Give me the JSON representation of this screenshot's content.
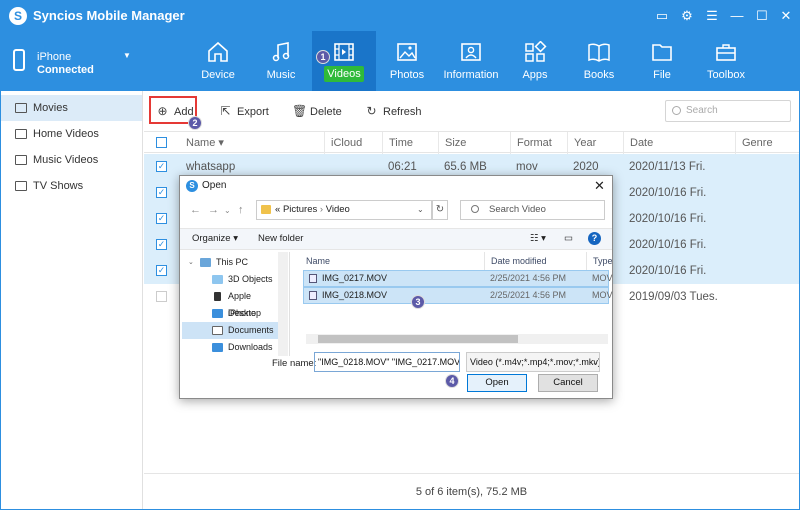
{
  "app": {
    "title": "Syncios Mobile Manager",
    "accent": "#2d8fe0"
  },
  "device": {
    "name": "iPhone",
    "status": "Connected"
  },
  "nav": [
    {
      "label": "Device",
      "icon": "home-icon"
    },
    {
      "label": "Music",
      "icon": "music-note-icon"
    },
    {
      "label": "Videos",
      "icon": "film-icon"
    },
    {
      "label": "Photos",
      "icon": "image-icon"
    },
    {
      "label": "Information",
      "icon": "contact-card-icon"
    },
    {
      "label": "Apps",
      "icon": "apps-grid-icon"
    },
    {
      "label": "Books",
      "icon": "book-icon"
    },
    {
      "label": "File",
      "icon": "file-icon"
    },
    {
      "label": "Toolbox",
      "icon": "toolbox-icon"
    }
  ],
  "sidebar": {
    "items": [
      {
        "label": "Movies"
      },
      {
        "label": "Home Videos"
      },
      {
        "label": "Music Videos"
      },
      {
        "label": "TV Shows"
      }
    ]
  },
  "toolbar": {
    "add": "Add",
    "export": "Export",
    "delete": "Delete",
    "refresh": "Refresh",
    "search_placeholder": "Search"
  },
  "table": {
    "headers": [
      "Name",
      "iCloud",
      "Time",
      "Size",
      "Format",
      "Year",
      "Date",
      "Genre"
    ],
    "rows": [
      {
        "name": "whatsapp",
        "time": "06:21",
        "size": "65.6 MB",
        "format": "mov",
        "year": "2020",
        "date": "2020/11/13 Fri.",
        "checked": true
      },
      {
        "date": "2020/10/16 Fri.",
        "checked": true
      },
      {
        "date": "2020/10/16 Fri.",
        "checked": true
      },
      {
        "date": "2020/10/16 Fri.",
        "checked": true
      },
      {
        "date": "2020/10/16 Fri.",
        "checked": true
      },
      {
        "date": "2019/09/03 Tues.",
        "checked": false
      }
    ]
  },
  "status": "5 of 6 item(s), 75.2 MB",
  "badges": [
    "1",
    "2",
    "3",
    "4"
  ],
  "dialog": {
    "title": "Open",
    "path_prefix": "«",
    "path": [
      "Pictures",
      "Video"
    ],
    "search_placeholder": "Search Video",
    "organize": "Organize",
    "new_folder": "New folder",
    "tree": [
      "This PC",
      "3D Objects",
      "Apple iPhone",
      "Desktop",
      "Documents",
      "Downloads"
    ],
    "columns": [
      "Name",
      "Date modified",
      "Type"
    ],
    "files": [
      {
        "name": "IMG_0217.MOV",
        "date": "2/25/2021 4:56 PM",
        "type": "MOV"
      },
      {
        "name": "IMG_0218.MOV",
        "date": "2/25/2021 4:56 PM",
        "type": "MOV"
      }
    ],
    "file_name_label": "File name:",
    "file_name_value": "\"IMG_0218.MOV\" \"IMG_0217.MOV\"",
    "file_type_value": "Video (*.m4v;*.mp4;*.mov;*.mkv)",
    "open": "Open",
    "cancel": "Cancel"
  }
}
